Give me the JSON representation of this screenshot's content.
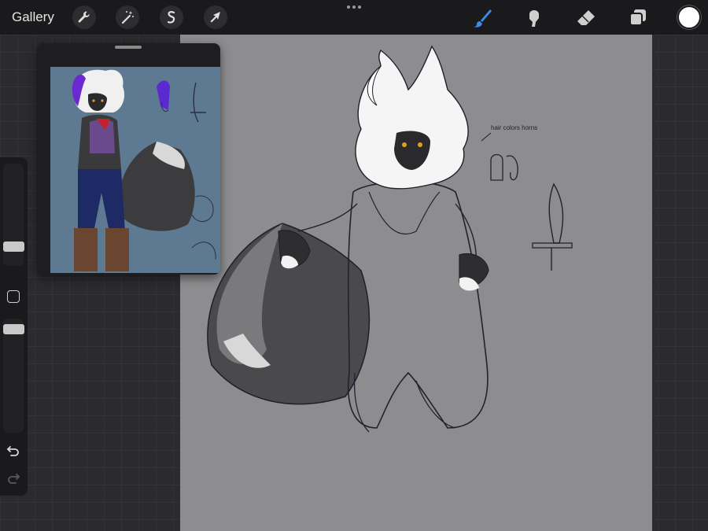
{
  "app": {
    "gallery_label": "Gallery"
  },
  "toolbar": {
    "left_tools": [
      "wrench-icon",
      "magic-wand-icon",
      "selection-icon",
      "transform-arrow-icon"
    ],
    "right_tools": [
      "brush-icon",
      "smudge-icon",
      "eraser-icon",
      "layers-icon"
    ],
    "active_tool": "brush-icon",
    "active_color": "#3d8be8",
    "current_color": "#ffffff"
  },
  "canvas": {
    "annotation_text": "hair colors horns",
    "background_color": "#8d8d8f"
  },
  "sidebar": {
    "brush_size_level": 0.14,
    "opacity_level": 0.95,
    "undo_icon": "undo-icon",
    "redo_icon": "redo-icon"
  },
  "reference": {
    "window_label": "reference"
  }
}
